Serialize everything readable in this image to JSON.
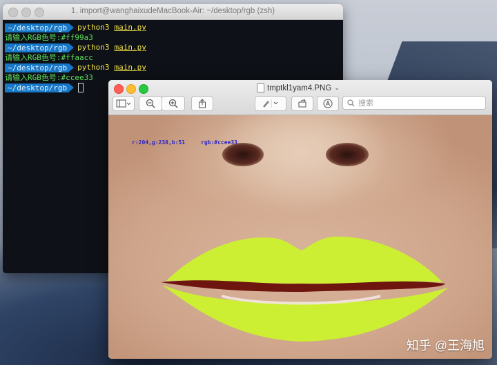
{
  "terminal": {
    "title": "1. import@wanghaixudeMacBook-Air: ~/desktop/rgb (zsh)",
    "prompt": "~/desktop/rgb",
    "command": "python3",
    "script": "main.py",
    "lines": [
      {
        "type": "cmd"
      },
      {
        "type": "out",
        "text": "请输入RGB色号:#ff99a3"
      },
      {
        "type": "cmd"
      },
      {
        "type": "out",
        "text": "请输入RGB色号:#ffaacc"
      },
      {
        "type": "cmd"
      },
      {
        "type": "out",
        "text": "请输入RGB色号:#ccee33"
      },
      {
        "type": "prompt-only"
      }
    ]
  },
  "preview": {
    "title": "tmptkl1yam4.PNG",
    "search_placeholder": "搜索",
    "overlay_rgb_values": "r:204,g:238,b:51",
    "overlay_hex": "rgb:#ccee33",
    "lip_color": "#ccee33"
  },
  "watermark": "知乎 @王海旭"
}
